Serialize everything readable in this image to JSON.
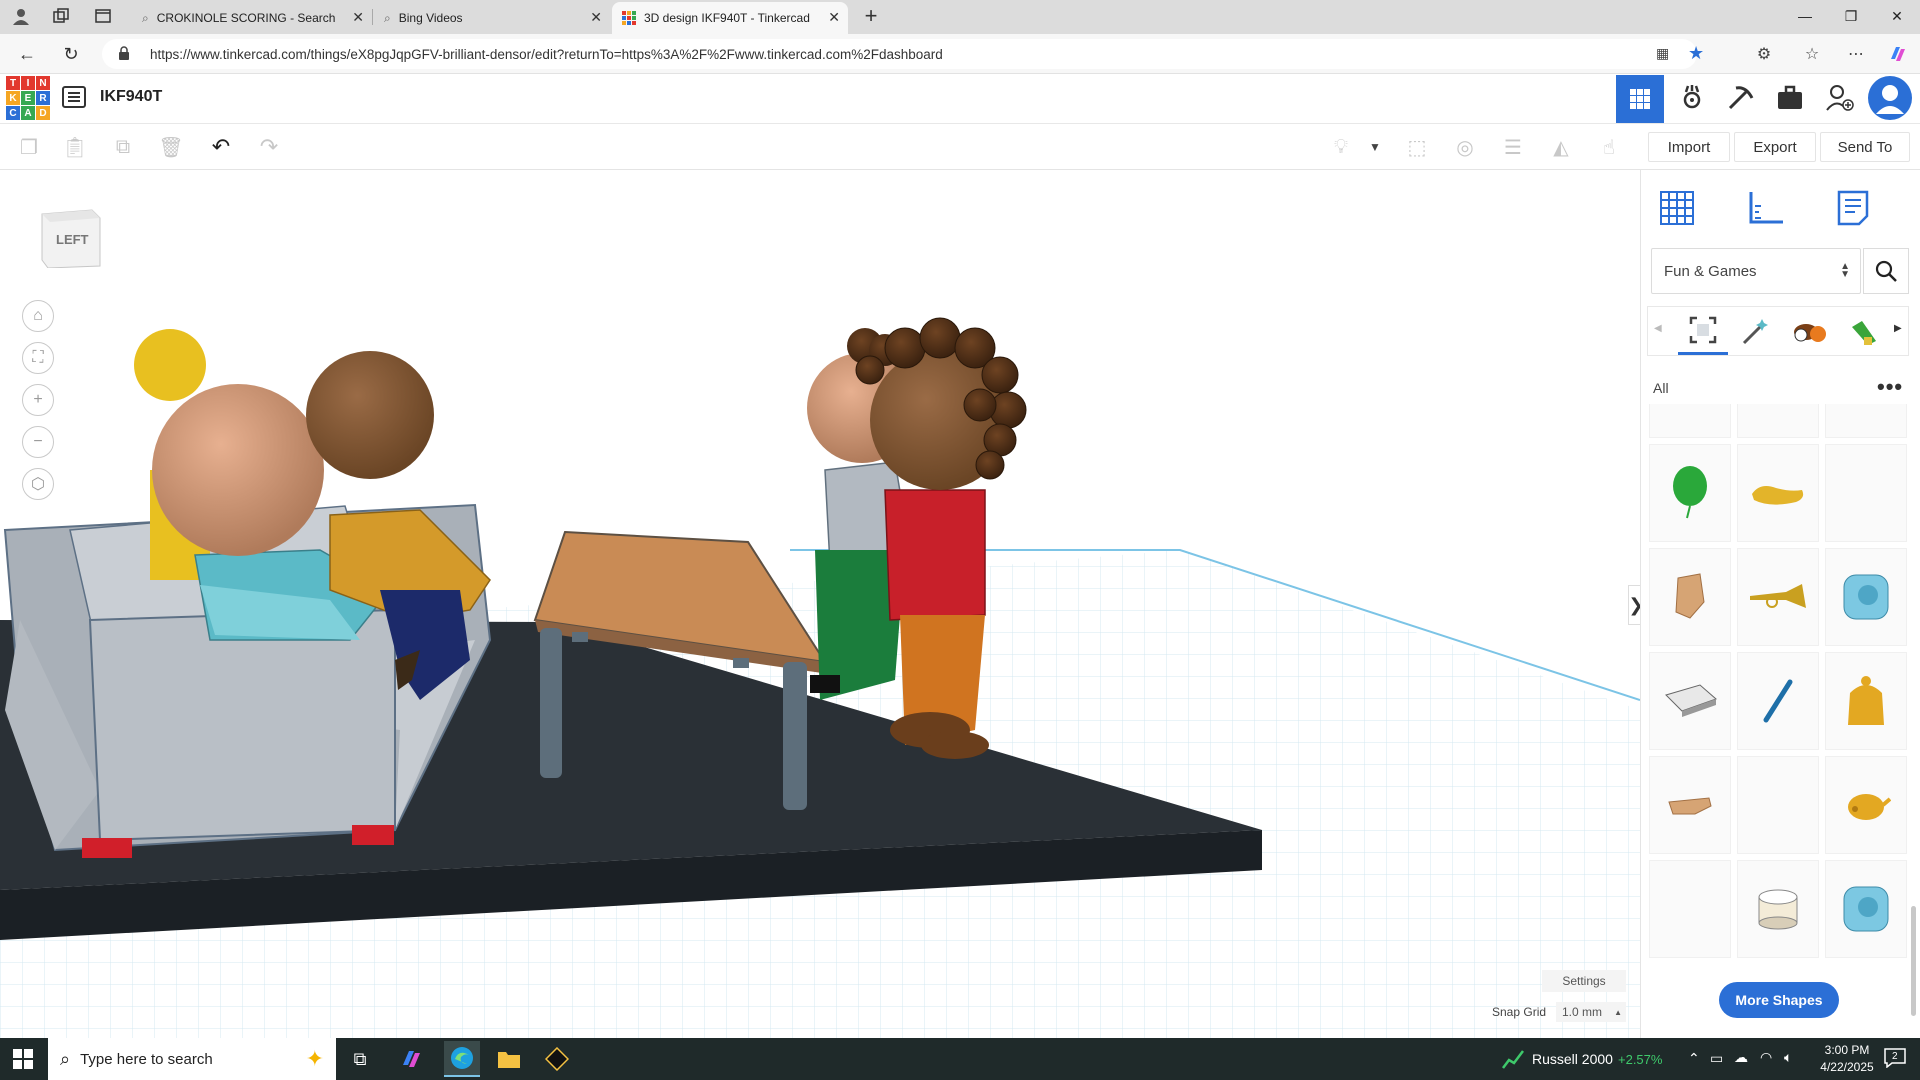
{
  "browser": {
    "tabs": [
      {
        "title": "CROKINOLE SCORING - Search",
        "icon": "search-icon"
      },
      {
        "title": "Bing Videos",
        "icon": "search-icon"
      },
      {
        "title": "3D design IKF940T - Tinkercad",
        "icon": "tinkercad-icon",
        "active": true
      }
    ],
    "new_tab_symbol": "+",
    "url": "https://www.tinkercad.com/things/eX8pgJqpGFV-brilliant-densor/edit?returnTo=https%3A%2F%2Fwww.tinkercad.com%2Fdashboard",
    "url_host": "www.tinkercad.com"
  },
  "app": {
    "logo_letters": [
      "T",
      "I",
      "N",
      "K",
      "E",
      "R",
      "C",
      "A",
      "D"
    ],
    "logo_colors": [
      "#e2382e",
      "#e2382e",
      "#e2382e",
      "#f5a623",
      "#36a852",
      "#2b6fd6",
      "#2b6fd6",
      "#36a852",
      "#f5a623"
    ],
    "design_title": "IKF940T"
  },
  "toolbar": {
    "import_label": "Import",
    "export_label": "Export",
    "send_to_label": "Send To"
  },
  "workplane": {
    "viewcube_label": "LEFT",
    "settings_label": "Settings",
    "snap_grid_label": "Snap Grid",
    "snap_grid_value": "1.0 mm"
  },
  "panel": {
    "category": "Fun & Games",
    "filter_label": "All",
    "more_shapes_label": "More Shapes",
    "toggle_symbol": "❯"
  },
  "taskbar": {
    "search_placeholder": "Type here to search",
    "stock_name": "Russell 2000",
    "stock_change": "+2.57%",
    "time": "3:00 PM",
    "date": "4/22/2025",
    "notification_count": "2"
  },
  "colors": {
    "brand_blue": "#2b6fd6",
    "workplane_grid": "#d8ecf6",
    "platform": "#232a30",
    "stock_green": "#3ec96b"
  }
}
